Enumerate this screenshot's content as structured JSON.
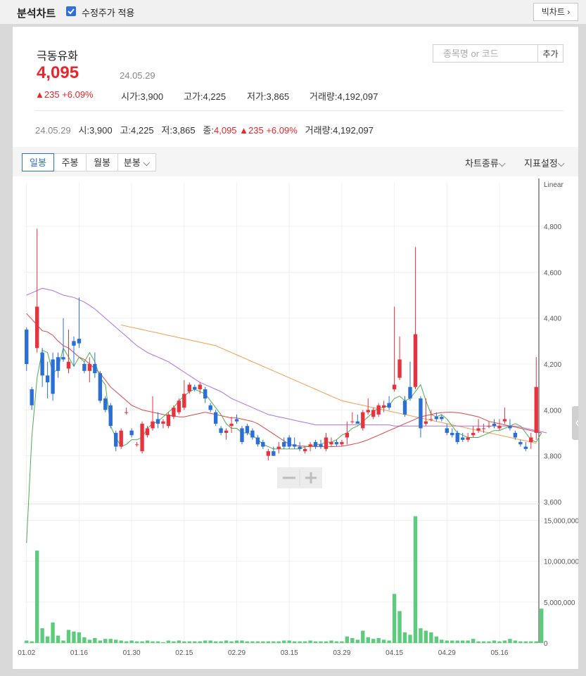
{
  "header": {
    "title": "분석차트",
    "adjust_label": "수정주가 적용",
    "big_chart_label": "빅차트"
  },
  "stock": {
    "name": "극동유화",
    "price": "4,095",
    "date": "24.05.29",
    "change": "▲235 +6.09%",
    "open_label": "시가",
    "open": "3,900",
    "high_label": "고가",
    "high": "4,225",
    "low_label": "저가",
    "low": "3,865",
    "volume_label": "거래량",
    "volume": "4,192,097"
  },
  "search": {
    "placeholder": "종목명 or 코드",
    "button": "추가"
  },
  "summary": {
    "date": "24.05.29",
    "open_label": "시",
    "open": "3,900",
    "high_label": "고",
    "high": "4,225",
    "low_label": "저",
    "low": "3,865",
    "close_label": "종",
    "close": "4,095",
    "change": "▲235 +6.09%",
    "volume_label": "거래량",
    "volume": "4,192,097"
  },
  "toolbar": {
    "tabs": [
      "일봉",
      "주봉",
      "월봉",
      "분봉"
    ],
    "chart_type": "차트종류",
    "indicator": "지표설정"
  },
  "colors": {
    "up": "#e8333e",
    "down": "#2a6fd6",
    "volume": "#5ccc7c",
    "ma5": "#4caf50",
    "ma20": "#e04545",
    "ma60": "#b070e0",
    "ma120": "#f0a050"
  },
  "chart_data": {
    "type": "candlestick",
    "scale_label": "Linear",
    "price_ticks": [
      3600,
      3800,
      4000,
      4200,
      4400,
      4600,
      4800
    ],
    "price_tick_labels": [
      "3,600",
      "3,800",
      "4,000",
      "4,200",
      "4,400",
      "4,600",
      "4,800"
    ],
    "price_range": [
      3600,
      4990
    ],
    "volume_ticks": [
      0,
      5000000,
      10000000,
      15000000
    ],
    "volume_tick_labels": [
      "0",
      "5,000,000",
      "10,000,000",
      "15,000,000"
    ],
    "volume_range": [
      0,
      16500000
    ],
    "x_tick_labels": [
      "01.02",
      "01.16",
      "01.30",
      "02.15",
      "02.29",
      "03.15",
      "03.29",
      "04.15",
      "04.29",
      "05.16"
    ],
    "x_tick_index": [
      0,
      10,
      20,
      30,
      40,
      50,
      60,
      70,
      80,
      90
    ],
    "ohlc": [
      [
        4350,
        4360,
        4170,
        4200
      ],
      [
        4090,
        4100,
        4000,
        4020
      ],
      [
        4270,
        4790,
        4250,
        4450
      ],
      [
        4250,
        4270,
        4100,
        4150
      ],
      [
        4150,
        4210,
        4050,
        4120
      ],
      [
        4220,
        4250,
        4040,
        4070
      ],
      [
        4230,
        4250,
        4140,
        4170
      ],
      [
        4230,
        4400,
        4210,
        4220
      ],
      [
        4180,
        4350,
        4160,
        4210
      ],
      [
        4300,
        4320,
        4190,
        4280
      ],
      [
        4310,
        4490,
        4270,
        4290
      ],
      [
        4200,
        4210,
        4160,
        4170
      ],
      [
        4170,
        4230,
        4120,
        4200
      ],
      [
        4200,
        4250,
        4140,
        4160
      ],
      [
        4160,
        4170,
        4030,
        4040
      ],
      [
        4050,
        4060,
        3990,
        4000
      ],
      [
        4020,
        4030,
        3920,
        3930
      ],
      [
        3900,
        3910,
        3820,
        3840
      ],
      [
        3840,
        3920,
        3830,
        3910
      ],
      [
        3990,
        4010,
        3980,
        3990
      ],
      [
        3910,
        3920,
        3880,
        3890
      ],
      [
        3850,
        3860,
        3840,
        3850
      ],
      [
        3820,
        3950,
        3810,
        3940
      ],
      [
        3890,
        3930,
        3880,
        3920
      ],
      [
        3920,
        4060,
        3910,
        3950
      ],
      [
        3960,
        3990,
        3920,
        3940
      ],
      [
        3940,
        3960,
        3920,
        3950
      ],
      [
        3930,
        3990,
        3920,
        3980
      ],
      [
        3970,
        4020,
        3960,
        4010
      ],
      [
        3990,
        4050,
        3980,
        4040
      ],
      [
        4010,
        4130,
        4000,
        4070
      ],
      [
        4080,
        4120,
        4070,
        4110
      ],
      [
        4100,
        4110,
        4080,
        4090
      ],
      [
        4090,
        4120,
        4070,
        4110
      ],
      [
        4090,
        4100,
        4030,
        4050
      ],
      [
        4020,
        4030,
        3990,
        4000
      ],
      [
        3990,
        4000,
        3930,
        3940
      ],
      [
        3920,
        3930,
        3890,
        3900
      ],
      [
        3900,
        3920,
        3870,
        3910
      ],
      [
        3930,
        3970,
        3900,
        3940
      ],
      [
        3960,
        3980,
        3940,
        3950
      ],
      [
        3920,
        3930,
        3850,
        3860
      ],
      [
        3930,
        3940,
        3890,
        3900
      ],
      [
        3910,
        3920,
        3870,
        3880
      ],
      [
        3880,
        3890,
        3840,
        3850
      ],
      [
        3860,
        3870,
        3830,
        3840
      ],
      [
        3800,
        3830,
        3780,
        3820
      ],
      [
        3820,
        3840,
        3800,
        3800
      ],
      [
        3830,
        3860,
        3810,
        3840
      ],
      [
        3860,
        3880,
        3830,
        3840
      ],
      [
        3880,
        3890,
        3830,
        3840
      ],
      [
        3850,
        3880,
        3830,
        3840
      ],
      [
        3840,
        3860,
        3820,
        3830
      ],
      [
        3820,
        3840,
        3810,
        3830
      ],
      [
        3840,
        3860,
        3820,
        3850
      ],
      [
        3860,
        3870,
        3830,
        3840
      ],
      [
        3850,
        3870,
        3830,
        3840
      ],
      [
        3830,
        3900,
        3820,
        3880
      ],
      [
        3850,
        3880,
        3840,
        3860
      ],
      [
        3860,
        3870,
        3840,
        3850
      ],
      [
        3850,
        3870,
        3840,
        3860
      ],
      [
        3880,
        3950,
        3850,
        3900
      ],
      [
        3950,
        3990,
        3940,
        3950
      ],
      [
        3950,
        3980,
        3940,
        3940
      ],
      [
        3920,
        4000,
        3910,
        3990
      ],
      [
        3990,
        4050,
        3980,
        4000
      ],
      [
        3970,
        4010,
        3960,
        4000
      ],
      [
        3980,
        4030,
        3970,
        4020
      ],
      [
        4010,
        4040,
        3990,
        4020
      ],
      [
        4030,
        4060,
        4000,
        4010
      ],
      [
        4090,
        4450,
        4080,
        4110
      ],
      [
        4140,
        4320,
        4130,
        4220
      ],
      [
        4040,
        4060,
        3970,
        3980
      ],
      [
        4100,
        4210,
        4040,
        4050
      ],
      [
        4100,
        4710,
        4090,
        4330
      ],
      [
        4050,
        4060,
        3880,
        3920
      ],
      [
        3940,
        4050,
        3930,
        3950
      ],
      [
        3960,
        4000,
        3950,
        3960
      ],
      [
        3970,
        3990,
        3950,
        3960
      ],
      [
        3970,
        3980,
        3950,
        3960
      ],
      [
        3920,
        3940,
        3890,
        3900
      ],
      [
        3900,
        3920,
        3880,
        3890
      ],
      [
        3900,
        3910,
        3850,
        3860
      ],
      [
        3880,
        3900,
        3860,
        3870
      ],
      [
        3870,
        3900,
        3860,
        3880
      ],
      [
        3890,
        3930,
        3880,
        3900
      ],
      [
        3910,
        3960,
        3900,
        3920
      ],
      [
        3920,
        3940,
        3900,
        3920
      ],
      [
        3930,
        3950,
        3920,
        3930
      ],
      [
        3940,
        3960,
        3920,
        3930
      ],
      [
        3920,
        3960,
        3910,
        3930
      ],
      [
        3950,
        4010,
        3940,
        3960
      ],
      [
        3930,
        3960,
        3910,
        3920
      ],
      [
        3900,
        3910,
        3870,
        3880
      ],
      [
        3860,
        3870,
        3840,
        3850
      ],
      [
        3840,
        3860,
        3820,
        3830
      ],
      [
        3860,
        3900,
        3830,
        3880
      ],
      [
        3900,
        4230,
        3870,
        4100
      ]
    ],
    "volume": [
      300000,
      200000,
      11300000,
      1800000,
      800000,
      2500000,
      900000,
      300000,
      1600000,
      1400000,
      1300000,
      700000,
      400000,
      600000,
      300000,
      500000,
      500000,
      400000,
      300000,
      200000,
      300000,
      200000,
      200000,
      300000,
      200000,
      200000,
      100000,
      300000,
      200000,
      300000,
      200000,
      200000,
      200000,
      200000,
      300000,
      300000,
      200000,
      200000,
      300000,
      200000,
      300000,
      300000,
      200000,
      200000,
      200000,
      200000,
      200000,
      200000,
      200000,
      300000,
      300000,
      200000,
      200000,
      200000,
      300000,
      200000,
      200000,
      200000,
      300000,
      200000,
      200000,
      800000,
      600000,
      400000,
      1500000,
      700000,
      500000,
      600000,
      400000,
      300000,
      6000000,
      3900000,
      1300000,
      1000000,
      15500000,
      1800000,
      1500000,
      1300000,
      800000,
      400000,
      300000,
      300000,
      300000,
      300000,
      300000,
      500000,
      200000,
      200000,
      200000,
      300000,
      200000,
      300000,
      500000,
      300000,
      200000,
      200000,
      200000,
      200000,
      4200000
    ],
    "ma5": [
      3420,
      3880,
      4140,
      4260,
      4250,
      4160,
      4180,
      4270,
      4230,
      4190,
      4230,
      4210,
      4250,
      4210,
      4140,
      4110,
      3930,
      3880,
      3840,
      3850,
      3870,
      3870,
      3880,
      3920,
      3940,
      3950,
      3970,
      3990,
      4010,
      4040,
      4060,
      4080,
      4090,
      4080,
      4070,
      4040,
      4010,
      3980,
      3940,
      3920,
      3920,
      3900,
      3900,
      3890,
      3870,
      3850,
      3840,
      3830,
      3830,
      3830,
      3830,
      3830,
      3830,
      3840,
      3840,
      3850,
      3850,
      3860,
      3860,
      3870,
      3890,
      3900,
      3920,
      3930,
      3950,
      3970,
      3990,
      4010,
      4010,
      4020,
      4050,
      4060,
      4040,
      4050,
      4080,
      4110,
      4040,
      3980,
      3970,
      3980,
      3960,
      3930,
      3900,
      3890,
      3880,
      3880,
      3880,
      3890,
      3900,
      3910,
      3910,
      3920,
      3930,
      3940,
      3930,
      3900,
      3870,
      3860,
      3900
    ],
    "ma20": [
      4420,
      4395,
      4370,
      4345,
      4340,
      4325,
      4300,
      4280,
      4270,
      4250,
      4230,
      4220,
      4200,
      4180,
      4160,
      4130,
      4100,
      4080,
      4060,
      4040,
      4020,
      4010,
      4000,
      3995,
      3990,
      3985,
      3980,
      3975,
      3975,
      3970,
      3970,
      3975,
      3980,
      3985,
      3990,
      3985,
      3980,
      3975,
      3970,
      3965,
      3965,
      3960,
      3955,
      3950,
      3940,
      3925,
      3910,
      3895,
      3880,
      3865,
      3850,
      3845,
      3843,
      3842,
      3841,
      3840,
      3840,
      3840,
      3840,
      3841,
      3842,
      3846,
      3850,
      3855,
      3862,
      3870,
      3880,
      3890,
      3900,
      3910,
      3920,
      3930,
      3940,
      3950,
      3960,
      3970,
      3975,
      3980,
      3985,
      3988,
      3990,
      3990,
      3988,
      3985,
      3980,
      3975,
      3970,
      3960,
      3950,
      3945,
      3940,
      3935,
      3930,
      3925,
      3920,
      3915,
      3910,
      3905,
      3900
    ],
    "ma60": [
      4500,
      4510,
      4520,
      4530,
      4525,
      4520,
      4510,
      4500,
      4495,
      4490,
      4480,
      4470,
      4455,
      4440,
      4420,
      4400,
      4380,
      4360,
      4340,
      4320,
      4300,
      4280,
      4265,
      4250,
      4240,
      4230,
      4220,
      4210,
      4195,
      4180,
      4165,
      4150,
      4135,
      4120,
      4110,
      4100,
      4090,
      4080,
      4065,
      4050,
      4040,
      4030,
      4020,
      4010,
      4000,
      3990,
      3980,
      3975,
      3970,
      3965,
      3960,
      3955,
      3950,
      3945,
      3940,
      3935,
      3935,
      3935,
      3935,
      3935,
      3935,
      3935,
      3935,
      3935,
      3935,
      3935,
      3935,
      3935,
      3935,
      3935,
      3930,
      3930,
      3930,
      3930,
      3930,
      3930,
      3930,
      3930,
      3930,
      3930,
      3930,
      3930,
      3930,
      3930,
      3930,
      3930,
      3930,
      3930,
      3930,
      3930,
      3930,
      3930,
      3930,
      3930,
      3925,
      3920,
      3915,
      3910,
      3905,
      3900
    ],
    "ma120": [
      null,
      null,
      null,
      null,
      null,
      null,
      null,
      null,
      null,
      null,
      null,
      null,
      null,
      null,
      null,
      null,
      null,
      null,
      4370,
      4365,
      4360,
      4355,
      4350,
      4345,
      4340,
      4335,
      4330,
      4325,
      4320,
      4315,
      4310,
      4305,
      4300,
      4295,
      4290,
      4285,
      4280,
      4270,
      4260,
      4250,
      4240,
      4230,
      4220,
      4210,
      4200,
      4190,
      4180,
      4170,
      4160,
      4150,
      4140,
      4130,
      4120,
      4110,
      4100,
      4090,
      4080,
      4070,
      4060,
      4050,
      4040,
      4035,
      4030,
      4025,
      4020,
      4015,
      4010,
      4005,
      4000,
      3995,
      3990,
      3985,
      3980,
      3975,
      3970,
      3965,
      3960,
      3955,
      3950,
      3945,
      3940,
      3935,
      3930,
      3925,
      3920,
      3915,
      3910,
      3905,
      3900,
      3895,
      3890,
      3885,
      3880,
      3875,
      3870,
      3865,
      3860,
      3855
    ]
  }
}
